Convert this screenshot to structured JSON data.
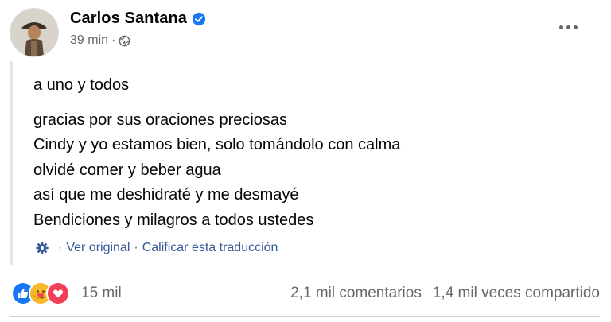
{
  "post": {
    "author": "Carlos Santana",
    "time": "39 min",
    "separator": "·",
    "lines_intro": [
      "a uno y todos"
    ],
    "lines": [
      "gracias por sus oraciones preciosas",
      "Cindy y yo estamos bien, solo tomándolo con calma",
      "olvidé comer y beber agua",
      "así que me deshidraté y me desmayé",
      "Bendiciones y milagros a todos ustedes"
    ],
    "translation": {
      "see_original": "Ver original",
      "separator": "·",
      "rate": "Calificar esta traducción"
    }
  },
  "footer": {
    "reactions_count": "15 mil",
    "comments": "2,1 mil comentarios",
    "shares": "1,4 mil veces compartido"
  },
  "icons": {
    "verified": "verified-badge-icon",
    "audience": "globe-icon",
    "more": "more-options-icon",
    "translate": "gear-icon",
    "reactions": [
      "like-icon",
      "care-icon",
      "love-icon"
    ]
  },
  "colors": {
    "accent": "#1877f2",
    "love": "#f33e58",
    "care": "#f7b928",
    "link": "#385898",
    "muted": "#65676b"
  }
}
